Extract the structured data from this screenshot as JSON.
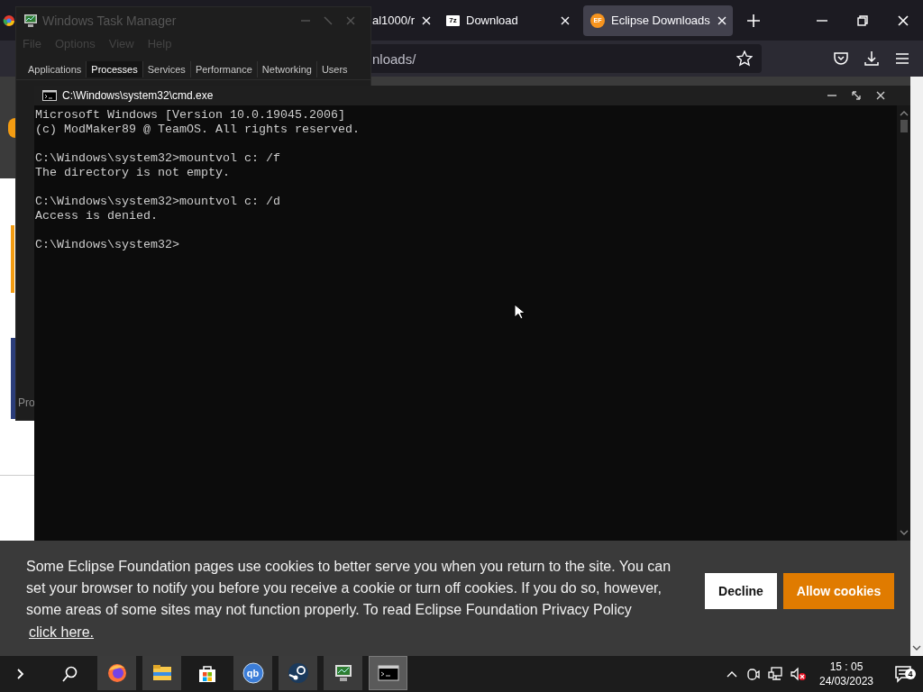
{
  "browser": {
    "tabs": [
      {
        "label": "al1000/r",
        "selected": false
      },
      {
        "label": "Download",
        "favicon_text": "7z",
        "selected": false
      },
      {
        "label": "Eclipse Downloads",
        "favicon_text": "EF",
        "selected": true
      }
    ],
    "address": "nloads/",
    "cookie_banner": {
      "message": "Some Eclipse Foundation pages use cookies to better serve you when you return to the site. You can set your browser to notify you before you receive a cookie or turn off cookies. If you do so, however, some areas of some sites may not function properly. To read Eclipse Foundation Privacy Policy",
      "link": "click here.",
      "buttons": [
        {
          "label": "Decline",
          "kind": "secondary"
        },
        {
          "label": "Allow cookies",
          "kind": "primary"
        }
      ]
    }
  },
  "task_manager": {
    "title": "Windows Task Manager",
    "menu": [
      "File",
      "Options",
      "View",
      "Help"
    ],
    "tabs": [
      {
        "label": "Applications",
        "selected": false
      },
      {
        "label": "Processes",
        "selected": true
      },
      {
        "label": "Services",
        "selected": false
      },
      {
        "label": "Performance",
        "selected": false
      },
      {
        "label": "Networking",
        "selected": false
      },
      {
        "label": "Users",
        "selected": false
      }
    ],
    "footer_text": "Pro"
  },
  "console": {
    "title": "C:\\Windows\\system32\\cmd.exe",
    "blocks": [
      [
        "Microsoft Windows [Version 10.0.19045.2006]",
        "(c) ModMaker89 @ TeamOS. All rights reserved."
      ],
      [
        "C:\\Windows\\system32>mountvol c: /f",
        "The directory is not empty."
      ],
      [
        "C:\\Windows\\system32>mountvol c: /d",
        "Access is denied."
      ],
      [
        "C:\\Windows\\system32>"
      ]
    ]
  },
  "taskbar": {
    "apps": [
      {
        "kind": "firefox",
        "running": true,
        "selected": false
      },
      {
        "kind": "explorer",
        "running": true,
        "selected": false
      },
      {
        "kind": "store",
        "running": false,
        "selected": false
      },
      {
        "kind": "qbittorrent",
        "label": "qb",
        "running": true,
        "selected": false
      },
      {
        "kind": "steam",
        "running": true,
        "selected": false
      },
      {
        "kind": "monitor",
        "running": true,
        "selected": false
      },
      {
        "kind": "terminal",
        "running": true,
        "selected": true
      }
    ],
    "time": "15 : 05",
    "date": "24/03/2023",
    "notification_count": "4"
  }
}
